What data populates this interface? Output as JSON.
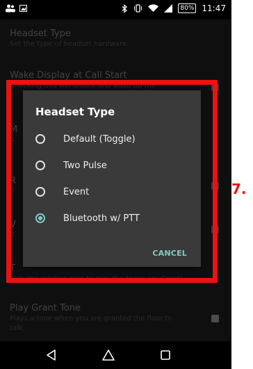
{
  "status_bar": {
    "battery": "80%",
    "time": "11:47"
  },
  "settings": [
    {
      "title": "Headset Type",
      "subtitle": "Set the type of headset hardware.",
      "checkbox": false
    },
    {
      "title": "Wake Display at Call Start",
      "subtitle": "Checking this will unlock and wake up the",
      "checkbox": true
    },
    {
      "title": "M",
      "subtitle": "A",
      "checkbox": false
    },
    {
      "title": "R",
      "subtitle": "P",
      "checkbox": true
    },
    {
      "title": "V",
      "subtitle": "V",
      "checkbox": true
    },
    {
      "title": "T",
      "subtitle": "Sets the relative gain to play the tones (ex Grant)",
      "checkbox": false
    },
    {
      "title": "Play Grant Tone",
      "subtitle": "Plays a tone when you are granted the floor to",
      "subtitle2": "talk.",
      "checkbox": true
    }
  ],
  "dialog": {
    "title": "Headset Type",
    "options": [
      {
        "label": "Default (Toggle)",
        "selected": false
      },
      {
        "label": "Two Pulse",
        "selected": false
      },
      {
        "label": "Event",
        "selected": false
      },
      {
        "label": "Bluetooth w/ PTT",
        "selected": true
      }
    ],
    "cancel_label": "CANCEL"
  },
  "annotation": {
    "step_label": "7."
  },
  "colors": {
    "accent": "#80cbc4",
    "annotation": "#ee1111"
  }
}
